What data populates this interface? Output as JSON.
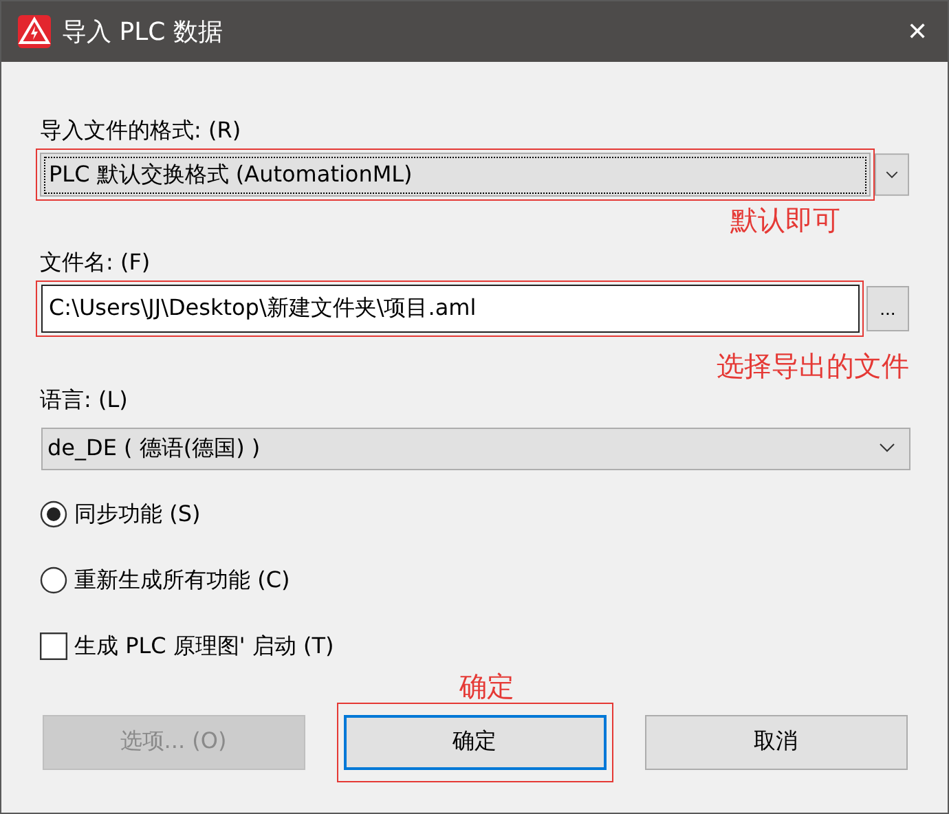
{
  "window": {
    "title": "导入 PLC 数据",
    "close": "✕"
  },
  "format": {
    "label": "导入文件的格式: (R)",
    "value": "PLC 默认交换格式 (AutomationML)",
    "highlighted": true,
    "note": "默认即可"
  },
  "file": {
    "label": "文件名: (F)",
    "value": "C:\\Users\\JJ\\Desktop\\新建文件夹\\项目.aml",
    "browse": "...",
    "highlighted": true,
    "note": "选择导出的文件"
  },
  "language": {
    "label": "语言: (L)",
    "value": "de_DE ( 德语(德国) )",
    "highlighted": false
  },
  "options": [
    {
      "kind": "radio",
      "label": "同步功能 (S)",
      "selected": true
    },
    {
      "kind": "radio",
      "label": "重新生成所有功能 (C)",
      "selected": false
    },
    {
      "kind": "checkbox",
      "label": "生成 PLC 原理图' 启动 (T)",
      "checked": false
    }
  ],
  "ok_note": "确定",
  "buttons": [
    {
      "label": "选项... (O)",
      "disabled": true,
      "default": false,
      "highlighted": false
    },
    {
      "label": "确定",
      "disabled": false,
      "default": true,
      "highlighted": true
    },
    {
      "label": "取消",
      "disabled": false,
      "default": false,
      "highlighted": false
    }
  ]
}
